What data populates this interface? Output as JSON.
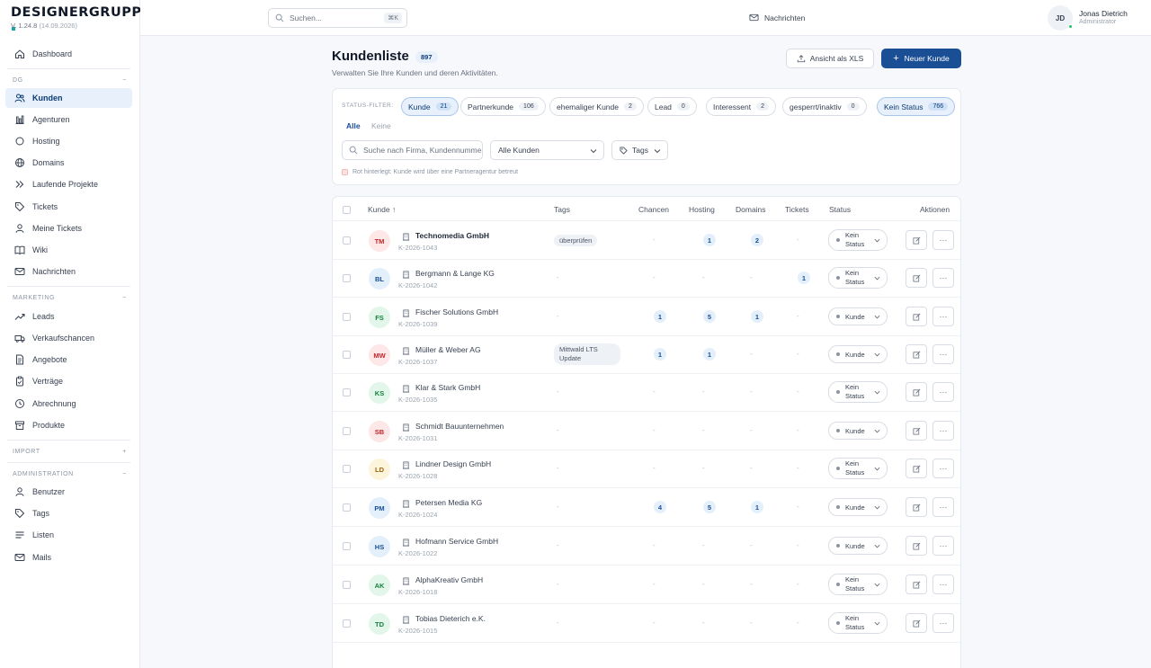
{
  "app": {
    "logo": "DESIGNERGRUPPE",
    "version": "V. 1.24.8",
    "version_date": "(14.09.2026)"
  },
  "sidebar": {
    "dashboard": "Dashboard",
    "dg_section": "DG",
    "dg_toggle": "−",
    "dg_items": [
      "Kunden",
      "Agenturen",
      "Hosting",
      "Domains",
      "Laufende Projekte",
      "Tickets",
      "Meine Tickets",
      "Wiki",
      "Nachrichten"
    ],
    "marketing_section": "MARKETING",
    "marketing_toggle": "−",
    "marketing_items": [
      "Leads",
      "Verkaufschancen",
      "Angebote",
      "Verträge",
      "Abrechnung",
      "Produkte"
    ],
    "import_section": "IMPORT",
    "import_toggle": "+",
    "admin_section": "ADMINISTRATION",
    "admin_toggle": "−",
    "admin_items": [
      "Benutzer",
      "Tags",
      "Listen",
      "Mails"
    ]
  },
  "topbar": {
    "search_placeholder": "Suchen...",
    "search_shortcut": "⌘K",
    "messages": "Nachrichten",
    "user_initials": "JD",
    "user_name": "Jonas Dietrich",
    "user_role": "Administrator"
  },
  "header": {
    "title": "Kundenliste",
    "count": "897",
    "subtitle": "Verwalten Sie Ihre Kunden und deren Aktivitäten.",
    "export_button": "Ansicht als XLS",
    "new_button": "Neuer Kunde"
  },
  "filters": {
    "status_label": "STATUS-FILTER:",
    "chips": [
      {
        "label": "Kunde",
        "count": "21"
      },
      {
        "label": "Partnerkunde",
        "count": "106"
      },
      {
        "label": "ehemaliger Kunde",
        "count": "2"
      },
      {
        "label": "Lead",
        "count": "0"
      },
      {
        "label": "Interessent",
        "count": "2"
      },
      {
        "label": "gesperrt/inaktiv",
        "count": "0"
      },
      {
        "label": "Kein Status",
        "count": "766"
      }
    ],
    "all": "Alle",
    "none": "Keine",
    "search_placeholder": "Suche nach Firma, Kundennummer",
    "select_value": "Alle Kunden",
    "tags_label": "Tags",
    "hint": "Rot hinterlegt: Kunde wird über eine Partneragentur betreut"
  },
  "table": {
    "columns": {
      "kunde": "Kunde ↑",
      "tags": "Tags",
      "chancen": "Chancen",
      "hosting": "Hosting",
      "domains": "Domains",
      "tickets": "Tickets",
      "status": "Status",
      "aktionen": "Aktionen"
    },
    "dash": "-",
    "rows": [
      {
        "initials": "TM",
        "color": "red",
        "name": "Technomedia GmbH",
        "bold": true,
        "id": "K-2026-1043",
        "tag": "überprüfen",
        "chancen": "",
        "hosting": "1",
        "domains": "2",
        "tickets": "",
        "status": "Kein Status"
      },
      {
        "initials": "BL",
        "color": "blue",
        "name": "Bergmann & Lange KG",
        "bold": false,
        "id": "K-2026-1042",
        "tag": "",
        "chancen": "",
        "hosting": "",
        "domains": "",
        "tickets": "1",
        "status": "Kein Status"
      },
      {
        "initials": "FS",
        "color": "green",
        "name": "Fischer Solutions GmbH",
        "bold": false,
        "id": "K-2026-1039",
        "tag": "",
        "chancen": "1",
        "hosting": "5",
        "domains": "1",
        "tickets": "",
        "status": "Kunde"
      },
      {
        "initials": "MW",
        "color": "red",
        "name": "Müller & Weber AG",
        "bold": false,
        "id": "K-2026-1037",
        "tag": "Mittwald LTS Update",
        "chancen": "1",
        "hosting": "1",
        "domains": "",
        "tickets": "",
        "status": "Kunde"
      },
      {
        "initials": "KS",
        "color": "green",
        "name": "Klar & Stark GmbH",
        "bold": false,
        "id": "K-2026-1035",
        "tag": "",
        "chancen": "",
        "hosting": "",
        "domains": "",
        "tickets": "",
        "status": "Kein Status"
      },
      {
        "initials": "SB",
        "color": "red",
        "name": "Schmidt Bauunternehmen",
        "bold": false,
        "id": "K-2026-1031",
        "tag": "",
        "chancen": "",
        "hosting": "",
        "domains": "",
        "tickets": "",
        "status": "Kunde"
      },
      {
        "initials": "LD",
        "color": "yellow",
        "name": "Lindner Design GmbH",
        "bold": false,
        "id": "K-2026-1028",
        "tag": "",
        "chancen": "",
        "hosting": "",
        "domains": "",
        "tickets": "",
        "status": "Kein Status"
      },
      {
        "initials": "PM",
        "color": "blue",
        "name": "Petersen Media KG",
        "bold": false,
        "id": "K-2026-1024",
        "tag": "",
        "chancen": "4",
        "hosting": "5",
        "domains": "1",
        "tickets": "",
        "status": "Kunde"
      },
      {
        "initials": "HS",
        "color": "blue",
        "name": "Hofmann Service GmbH",
        "bold": false,
        "id": "K-2026-1022",
        "tag": "",
        "chancen": "",
        "hosting": "",
        "domains": "",
        "tickets": "",
        "status": "Kunde"
      },
      {
        "initials": "AK",
        "color": "green",
        "name": "AlphaKreativ GmbH",
        "bold": false,
        "id": "K-2026-1018",
        "tag": "",
        "chancen": "",
        "hosting": "",
        "domains": "",
        "tickets": "",
        "status": "Kein Status"
      },
      {
        "initials": "TD",
        "color": "green",
        "name": "Tobias Dieterich e.K.",
        "bold": false,
        "id": "K-2026-1015",
        "tag": "",
        "chancen": "",
        "hosting": "",
        "domains": "",
        "tickets": "",
        "status": "Kein Status"
      }
    ]
  }
}
